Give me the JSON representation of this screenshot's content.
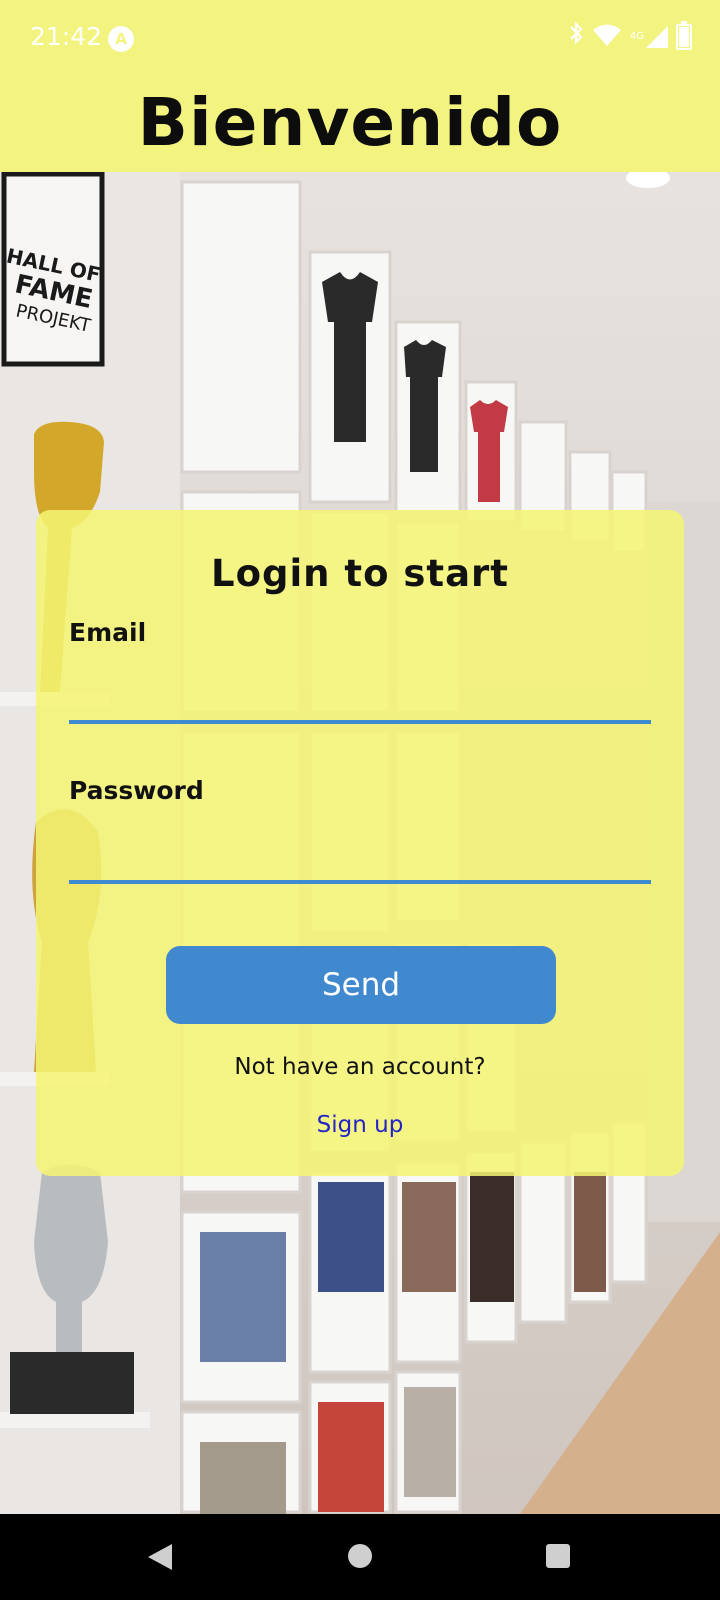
{
  "status_bar": {
    "time": "21:42",
    "app_icon": "A",
    "network_label": "4G",
    "icons": [
      "bluetooth-icon",
      "wifi-icon",
      "signal-icon",
      "battery-icon"
    ]
  },
  "header": {
    "title": "Bienvenido"
  },
  "background": {
    "sign_text": "HALL OF FAME PROJEKT"
  },
  "login": {
    "title": "Login to start",
    "email_label": "Email",
    "email_value": "",
    "password_label": "Password",
    "password_value": "",
    "send_label": "Send",
    "no_account_text": "Not have an account?",
    "signup_label": "Sign up"
  },
  "nav_bar": {
    "icons": [
      "back-icon",
      "home-icon",
      "recents-icon"
    ]
  },
  "colors": {
    "header_bg": "#f3f37f",
    "card_bg": "#f5f473",
    "accent": "#4189cf",
    "link": "#2323c8"
  }
}
